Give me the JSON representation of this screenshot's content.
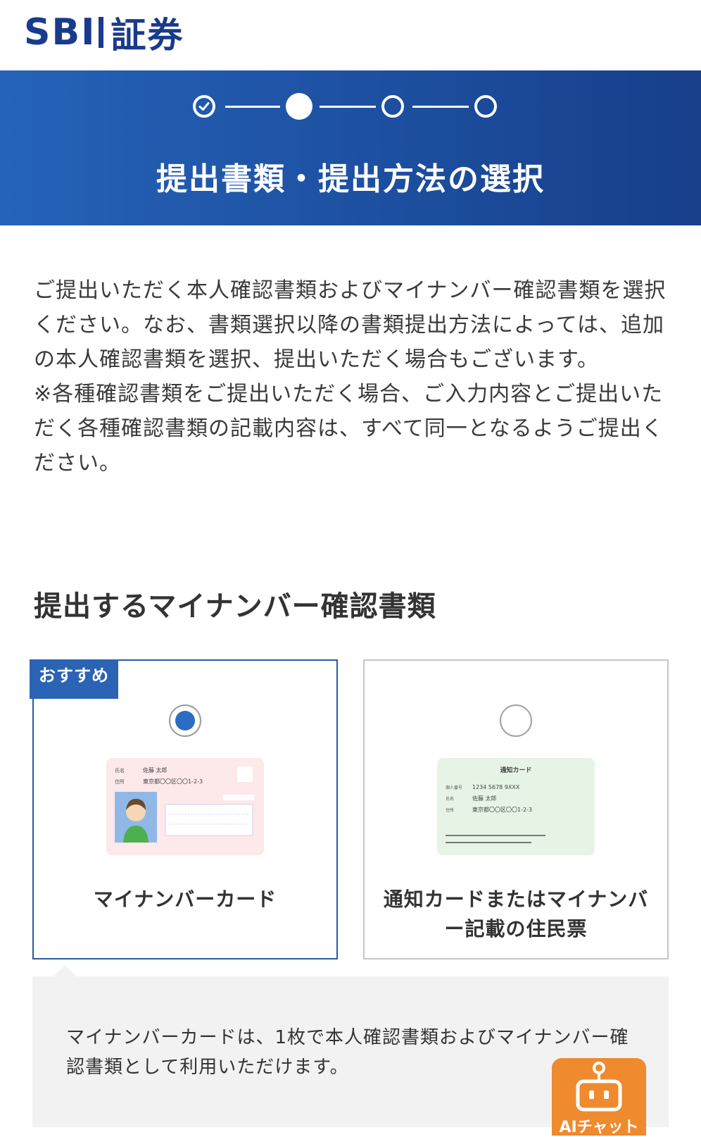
{
  "header": {
    "logo_latin": "SBI",
    "logo_japanese": "証券"
  },
  "stepper": {
    "total": 4,
    "current": 2
  },
  "page_title": "提出書類・提出方法の選択",
  "intro": {
    "paragraph1": "ご提出いただく本人確認書類およびマイナンバー確認書類を選択ください。なお、書類選択以降の書類提出方法によっては、追加の本人確認書類を選択、提出いただく場合もございます。",
    "paragraph2": "※各種確認書類をご提出いただく場合、ご入力内容とご提出いただく各種確認書類の記載内容は、すべて同一となるようご提出ください。"
  },
  "section_title": "提出するマイナンバー確認書類",
  "options": [
    {
      "label": "マイナンバーカード",
      "badge": "おすすめ",
      "selected": true,
      "card": {
        "name_label": "氏名",
        "name": "佐藤 太郎",
        "address_label": "住所",
        "address": "東京都〇〇区〇〇1-2-3"
      }
    },
    {
      "label": "通知カードまたはマイナンバー記載の住民票",
      "selected": false,
      "card": {
        "title": "通知カード",
        "number_label": "個人番号",
        "number": "1234 5678 9XXX",
        "name_label": "氏名",
        "name": "佐藤 太郎",
        "address_label": "住所",
        "address": "東京都〇〇区〇〇1-2-3"
      }
    }
  ],
  "info_text": "マイナンバーカードは、1枚で本人確認書類およびマイナンバー確認書類として利用いただけます。",
  "ai_chat": {
    "label": "AIチャット"
  },
  "colors": {
    "brand": "#1a3a8c",
    "accent": "#2b63b5",
    "ai_chat": "#f08a2e"
  }
}
